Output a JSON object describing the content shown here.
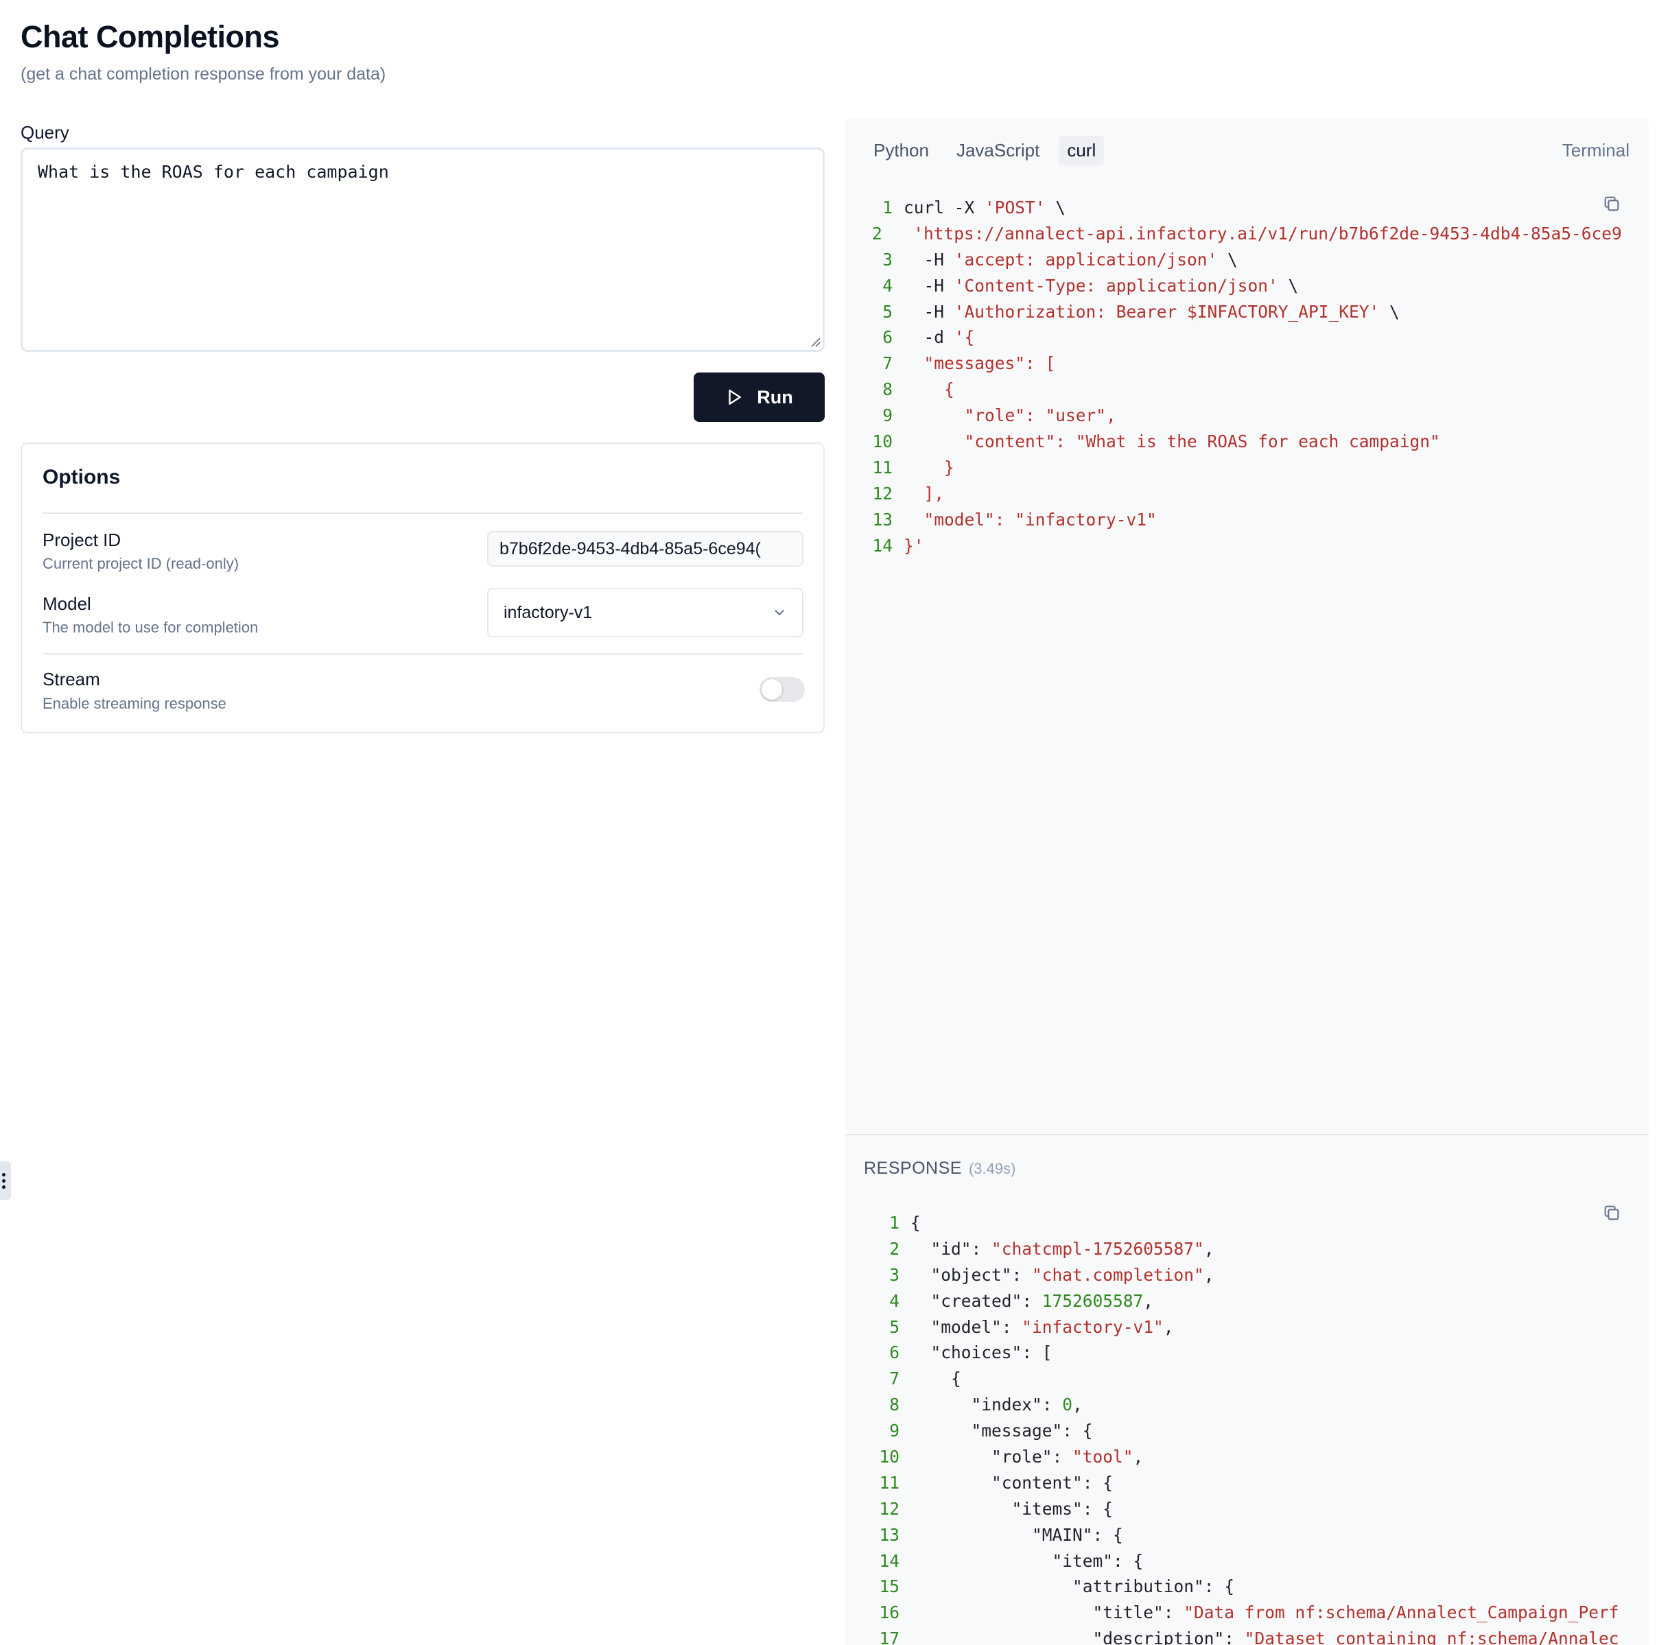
{
  "page": {
    "title": "Chat Completions",
    "subtitle": "(get a chat completion response from your data)"
  },
  "query": {
    "label": "Query",
    "value": "What is the ROAS for each campaign"
  },
  "run_button": {
    "label": "Run"
  },
  "options": {
    "title": "Options",
    "project_id": {
      "label": "Project ID",
      "description": "Current project ID (read-only)",
      "value": "b7b6f2de-9453-4db4-85a5-6ce94("
    },
    "model": {
      "label": "Model",
      "description": "The model to use for completion",
      "value": "infactory-v1"
    },
    "stream": {
      "label": "Stream",
      "description": "Enable streaming response",
      "enabled": false
    }
  },
  "code_panel": {
    "tabs": [
      {
        "label": "Python",
        "active": false
      },
      {
        "label": "JavaScript",
        "active": false
      },
      {
        "label": "curl",
        "active": true
      }
    ],
    "terminal_label": "Terminal",
    "lines": [
      [
        {
          "t": "curl -X "
        },
        {
          "s": "'POST'"
        },
        {
          "t": " \\"
        }
      ],
      [
        {
          "t": "  "
        },
        {
          "s": "'https://annalect-api.infactory.ai/v1/run/b7b6f2de-9453-4db4-85a5-6ce9"
        }
      ],
      [
        {
          "t": "  -H "
        },
        {
          "s": "'accept: application/json'"
        },
        {
          "t": " \\"
        }
      ],
      [
        {
          "t": "  -H "
        },
        {
          "s": "'Content-Type: application/json'"
        },
        {
          "t": " \\"
        }
      ],
      [
        {
          "t": "  -H "
        },
        {
          "s": "'Authorization: Bearer $INFACTORY_API_KEY'"
        },
        {
          "t": " \\"
        }
      ],
      [
        {
          "t": "  -d "
        },
        {
          "s": "'{"
        }
      ],
      [
        {
          "s": "  \"messages\": ["
        }
      ],
      [
        {
          "s": "    {"
        }
      ],
      [
        {
          "s": "      \"role\": \"user\","
        }
      ],
      [
        {
          "s": "      \"content\": \"What is the ROAS for each campaign\""
        }
      ],
      [
        {
          "s": "    }"
        }
      ],
      [
        {
          "s": "  ],"
        }
      ],
      [
        {
          "s": "  \"model\": \"infactory-v1\""
        }
      ],
      [
        {
          "s": "}'"
        }
      ]
    ]
  },
  "response": {
    "label": "RESPONSE",
    "time": "(3.49s)",
    "lines": [
      [
        {
          "t": "{"
        }
      ],
      [
        {
          "t": "  \"id\": "
        },
        {
          "s": "\"chatcmpl-1752605587\""
        },
        {
          "t": ","
        }
      ],
      [
        {
          "t": "  \"object\": "
        },
        {
          "s": "\"chat.completion\""
        },
        {
          "t": ","
        }
      ],
      [
        {
          "t": "  \"created\": "
        },
        {
          "n": "1752605587"
        },
        {
          "t": ","
        }
      ],
      [
        {
          "t": "  \"model\": "
        },
        {
          "s": "\"infactory-v1\""
        },
        {
          "t": ","
        }
      ],
      [
        {
          "t": "  \"choices\": ["
        }
      ],
      [
        {
          "t": "    {"
        }
      ],
      [
        {
          "t": "      \"index\": "
        },
        {
          "n": "0"
        },
        {
          "t": ","
        }
      ],
      [
        {
          "t": "      \"message\": {"
        }
      ],
      [
        {
          "t": "        \"role\": "
        },
        {
          "s": "\"tool\""
        },
        {
          "t": ","
        }
      ],
      [
        {
          "t": "        \"content\": {"
        }
      ],
      [
        {
          "t": "          \"items\": {"
        }
      ],
      [
        {
          "t": "            \"MAIN\": {"
        }
      ],
      [
        {
          "t": "              \"item\": {"
        }
      ],
      [
        {
          "t": "                \"attribution\": {"
        }
      ],
      [
        {
          "t": "                  \"title\": "
        },
        {
          "s": "\"Data from nf:schema/Annalect_Campaign_Perf"
        }
      ],
      [
        {
          "t": "                  \"description\": "
        },
        {
          "s": "\"Dataset containing nf:schema/Annalec"
        }
      ]
    ]
  },
  "colors": {
    "string": "#b3322d",
    "number": "#2f8a1f",
    "line_number": "#2f8a1f",
    "run_button_bg": "#111827"
  },
  "icons": [
    "play-icon",
    "chevron-down-icon",
    "copy-icon",
    "drag-handle-icon"
  ]
}
